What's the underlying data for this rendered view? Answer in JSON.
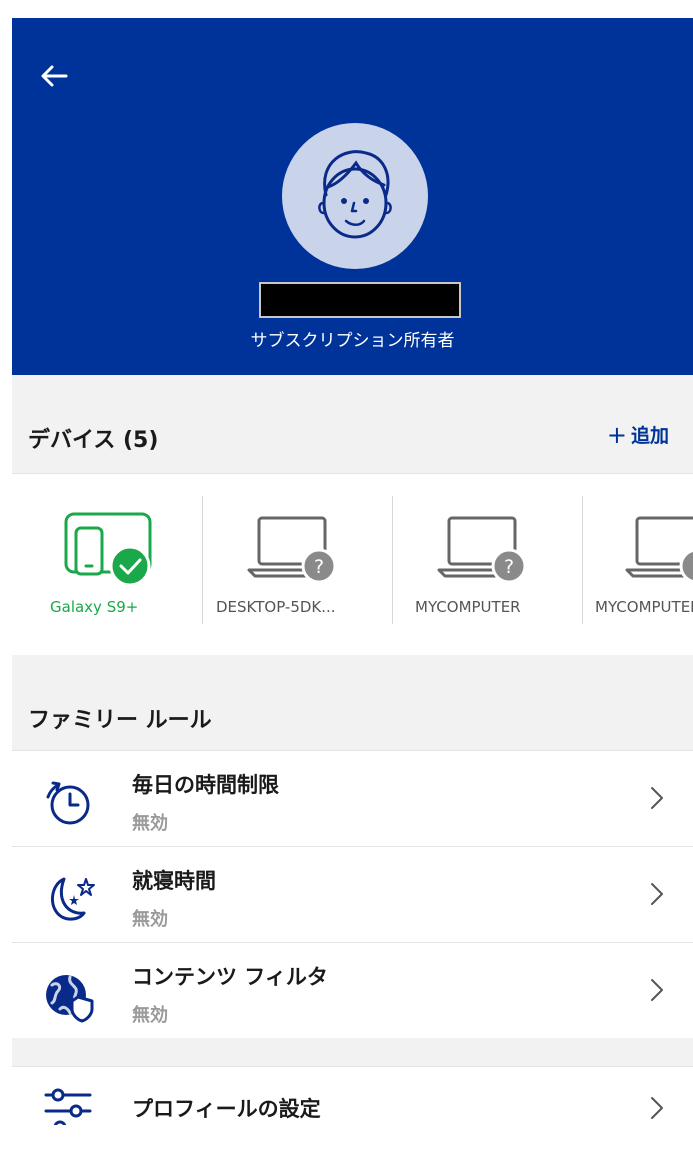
{
  "header": {
    "owner_label": "サブスクリプション所有者"
  },
  "devices": {
    "title": "デバイス (5)",
    "add_label": "追加",
    "items": [
      {
        "label": "Galaxy S9+",
        "type": "phone",
        "status": "protected"
      },
      {
        "label": "DESKTOP-5DK...",
        "type": "laptop",
        "status": "unknown"
      },
      {
        "label": "MYCOMPUTER",
        "type": "laptop",
        "status": "unknown"
      },
      {
        "label": "MYCOMPUTER",
        "type": "laptop",
        "status": "unknown"
      }
    ]
  },
  "family_rules": {
    "title": "ファミリー ルール",
    "items": [
      {
        "title": "毎日の時間制限",
        "status": "無効",
        "icon": "clock-icon"
      },
      {
        "title": "就寝時間",
        "status": "無効",
        "icon": "moon-stars-icon"
      },
      {
        "title": "コンテンツ フィルタ",
        "status": "無効",
        "icon": "globe-shield-icon"
      }
    ]
  },
  "settings": {
    "profile_label": "プロフィールの設定",
    "icon": "sliders-icon"
  },
  "colors": {
    "brand_blue": "#003399",
    "active_green": "#1aa84a",
    "unknown_gray": "#8a8a8a"
  }
}
